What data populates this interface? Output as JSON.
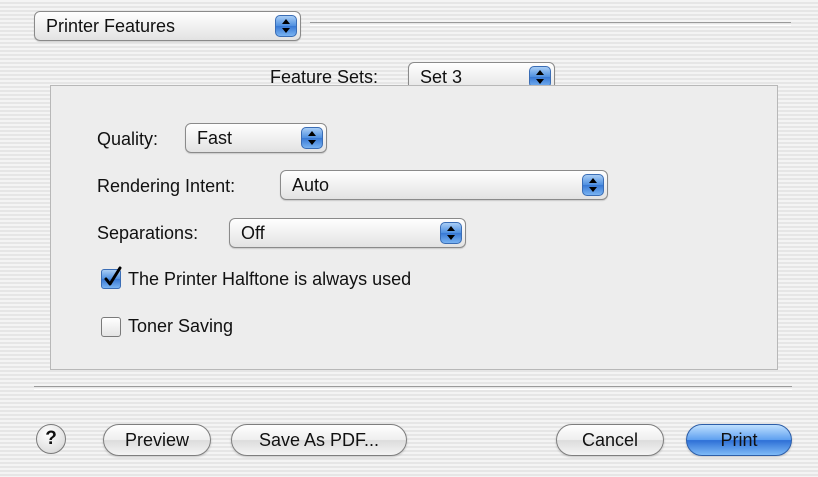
{
  "header": {
    "panel_menu": {
      "value": "Printer Features"
    }
  },
  "feature_sets": {
    "label": "Feature Sets:",
    "value": "Set 3"
  },
  "options": {
    "quality": {
      "label": "Quality:",
      "value": "Fast"
    },
    "rendering_intent": {
      "label": "Rendering Intent:",
      "value": "Auto"
    },
    "separations": {
      "label": "Separations:",
      "value": "Off"
    },
    "halftone": {
      "label": "The Printer Halftone is always used",
      "checked": true
    },
    "toner_saving": {
      "label": "Toner Saving",
      "checked": false
    }
  },
  "footer": {
    "help": {
      "label": "?"
    },
    "preview": {
      "label": "Preview"
    },
    "save_pdf": {
      "label": "Save As PDF..."
    },
    "cancel": {
      "label": "Cancel"
    },
    "print": {
      "label": "Print"
    }
  },
  "colors": {
    "accent": "#3878d4"
  }
}
